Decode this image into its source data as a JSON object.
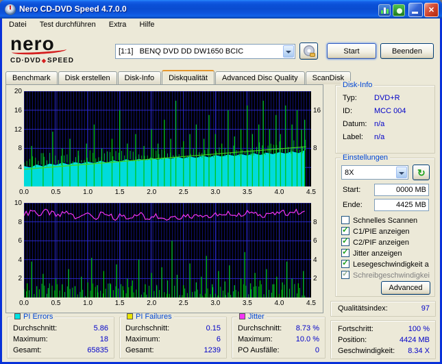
{
  "window": {
    "title": "Nero CD-DVD Speed 4.7.0.0"
  },
  "menu": {
    "items": [
      "Datei",
      "Test durchführen",
      "Extra",
      "Hilfe"
    ]
  },
  "logo": {
    "line1": "nero",
    "line2a": "CD·DVD",
    "diamond": "◆",
    "line2b": "SPEED"
  },
  "toolbar": {
    "drive": "[1:1]   BENQ DVD DD DW1650 BCIC",
    "start_label": "Start",
    "quit_label": "Beenden"
  },
  "tabs": {
    "items": [
      "Benchmark",
      "Disk erstellen",
      "Disk-Info",
      "Diskqualität",
      "Advanced Disc Quality",
      "ScanDisk"
    ],
    "active": "Diskqualität"
  },
  "disk_info": {
    "title": "Disk-Info",
    "rows": [
      {
        "label": "Typ:",
        "value": "DVD+R"
      },
      {
        "label": "ID:",
        "value": "MCC 004"
      },
      {
        "label": "Datum:",
        "value": "n/a"
      },
      {
        "label": "Label:",
        "value": "n/a"
      }
    ]
  },
  "settings": {
    "title": "Einstellungen",
    "speed": "8X",
    "start_label": "Start:",
    "start_value": "0000 MB",
    "end_label": "Ende:",
    "end_value": "4425 MB",
    "checkboxes": [
      {
        "label": "Schnelles Scannen",
        "checked": false,
        "disabled": false
      },
      {
        "label": "C1/PIE anzeigen",
        "checked": true,
        "disabled": false
      },
      {
        "label": "C2/PIF anzeigen",
        "checked": true,
        "disabled": false
      },
      {
        "label": "Jitter anzeigen",
        "checked": true,
        "disabled": false
      },
      {
        "label": "Lesegeschwindigkeit a",
        "checked": true,
        "disabled": false
      },
      {
        "label": "Schreibgeschwindigkei",
        "checked": true,
        "disabled": true
      }
    ],
    "advanced_label": "Advanced"
  },
  "quality": {
    "label": "Qualitätsindex:",
    "value": "97"
  },
  "progress": {
    "rows": [
      {
        "label": "Fortschritt:",
        "value": "100 %"
      },
      {
        "label": "Position:",
        "value": "4424 MB"
      },
      {
        "label": "Geschwindigkeit:",
        "value": "8.34 X"
      }
    ]
  },
  "stats": [
    {
      "title": "PI Errors",
      "color": "#00E3E3",
      "rows": [
        {
          "label": "Durchschnitt:",
          "value": "5.86"
        },
        {
          "label": "Maximum:",
          "value": "18"
        },
        {
          "label": "Gesamt:",
          "value": "65835"
        }
      ]
    },
    {
      "title": "PI Failures",
      "color": "#E8E300",
      "rows": [
        {
          "label": "Durchschnitt:",
          "value": "0.15"
        },
        {
          "label": "Maximum:",
          "value": "6"
        },
        {
          "label": "Gesamt:",
          "value": "1239"
        }
      ]
    },
    {
      "title": "Jitter",
      "color": "#F336F3",
      "rows": [
        {
          "label": "Durchschnitt:",
          "value": "8.73 %"
        },
        {
          "label": "Maximum:",
          "value": "10.0 %"
        },
        {
          "label": "PO Ausfälle:",
          "value": "0"
        }
      ]
    }
  ],
  "chart_data": [
    {
      "name": "PI Errors / Lesegeschwindigkeit",
      "type": "area",
      "x_max": 4.5,
      "x_tick_labels": [
        "0.0",
        "0.5",
        "1.0",
        "1.5",
        "2.0",
        "2.5",
        "3.0",
        "3.5",
        "4.0",
        "4.5"
      ],
      "y_left_max": 20,
      "y_left_ticks": [
        4,
        8,
        12,
        16,
        20
      ],
      "y_right_ticks": [
        8,
        16
      ],
      "series": [
        {
          "name": "PI Errors",
          "type": "area",
          "color": "#00DBDB",
          "x_step": 0.1,
          "values": [
            4.3,
            4.0,
            4.6,
            4.2,
            4.8,
            4.5,
            5.0,
            4.6,
            5.1,
            4.8,
            5.2,
            4.9,
            5.4,
            5.0,
            5.5,
            5.2,
            5.7,
            5.3,
            5.8,
            5.5,
            6.0,
            5.6,
            6.1,
            5.8,
            6.2,
            5.9,
            6.3,
            6.0,
            6.5,
            6.1,
            6.6,
            6.3,
            6.7,
            6.4,
            6.8,
            6.5,
            7.0,
            6.6,
            7.1,
            6.8,
            7.2,
            6.9,
            7.4,
            7.0,
            7.6
          ]
        },
        {
          "name": "PI Errors Streuung",
          "type": "grass",
          "above": true,
          "step": 0.045,
          "min": 0.4,
          "max": 2.4,
          "x_end": 4.42,
          "seed": 7,
          "color": "#00BF30"
        },
        {
          "name": "PI Errors Spitzen",
          "type": "spikes",
          "color": "#00C419",
          "points": [
            [
              0.12,
              8.5
            ],
            [
              0.3,
              7
            ],
            [
              0.45,
              11.5
            ],
            [
              0.6,
              8
            ],
            [
              0.72,
              10
            ],
            [
              0.85,
              7.5
            ],
            [
              0.98,
              9
            ],
            [
              1.1,
              13
            ],
            [
              1.22,
              8
            ],
            [
              1.38,
              10
            ],
            [
              1.5,
              16
            ],
            [
              1.62,
              9
            ],
            [
              1.75,
              11
            ],
            [
              1.88,
              8.5
            ],
            [
              2.0,
              12
            ],
            [
              2.1,
              9
            ],
            [
              2.2,
              14
            ],
            [
              2.3,
              10
            ],
            [
              2.38,
              18
            ],
            [
              2.5,
              9.5
            ],
            [
              2.6,
              11
            ],
            [
              2.7,
              13
            ],
            [
              2.82,
              10
            ],
            [
              2.9,
              15
            ],
            [
              3.0,
              11
            ],
            [
              3.1,
              9
            ],
            [
              3.2,
              16
            ],
            [
              3.3,
              10.5
            ],
            [
              3.4,
              12
            ],
            [
              3.5,
              17
            ],
            [
              3.58,
              11
            ],
            [
              3.68,
              13
            ],
            [
              3.75,
              18
            ],
            [
              3.85,
              12
            ],
            [
              3.95,
              15
            ],
            [
              4.02,
              11
            ],
            [
              4.1,
              17
            ],
            [
              4.2,
              13
            ],
            [
              4.28,
              16
            ],
            [
              4.35,
              12
            ],
            [
              4.4,
              14
            ]
          ]
        },
        {
          "name": "Lesegeschwindigkeit",
          "type": "line",
          "color": "#46D522",
          "x": [
            0,
            4.42
          ],
          "y": [
            3.6,
            8.34
          ]
        }
      ]
    },
    {
      "name": "Jitter / PI Failures",
      "type": "line",
      "x_max": 4.5,
      "x_tick_labels": [
        "0.0",
        "0.5",
        "1.0",
        "1.5",
        "2.0",
        "2.5",
        "3.0",
        "3.5",
        "4.0",
        "4.5"
      ],
      "y_left_max": 10,
      "y_left_ticks": [
        2,
        4,
        6,
        8,
        10
      ],
      "y_right_ticks": [
        2,
        4,
        6,
        8
      ],
      "series": [
        {
          "name": "PI Failures Rauschen",
          "type": "grass",
          "above": false,
          "step": 0.04,
          "min": 0.15,
          "max": 1.5,
          "x_end": 4.42,
          "seed": 3,
          "color": "#00C419"
        },
        {
          "name": "PI Failures",
          "type": "spikes",
          "color": "#00C419",
          "points": [
            [
              0.05,
              1.5
            ],
            [
              0.12,
              3.8
            ],
            [
              0.2,
              1.2
            ],
            [
              0.3,
              2.5
            ],
            [
              0.38,
              1.0
            ],
            [
              0.5,
              2.0
            ],
            [
              0.6,
              1.4
            ],
            [
              0.7,
              3.0
            ],
            [
              0.8,
              1.2
            ],
            [
              0.9,
              2.2
            ],
            [
              1.0,
              1.6
            ],
            [
              1.06,
              4.2
            ],
            [
              1.15,
              1.3
            ],
            [
              1.25,
              2.8
            ],
            [
              1.35,
              1.5
            ],
            [
              1.45,
              3.5
            ],
            [
              1.55,
              1.2
            ],
            [
              1.62,
              2.0
            ],
            [
              1.7,
              1.8
            ],
            [
              1.8,
              4.0
            ],
            [
              1.9,
              1.4
            ],
            [
              2.0,
              2.6
            ],
            [
              2.08,
              1.2
            ],
            [
              2.16,
              3.2
            ],
            [
              2.25,
              1.8
            ],
            [
              2.32,
              6.0
            ],
            [
              2.4,
              2.4
            ],
            [
              2.5,
              1.3
            ],
            [
              2.6,
              3.6
            ],
            [
              2.7,
              1.6
            ],
            [
              2.78,
              2.2
            ],
            [
              2.86,
              4.4
            ],
            [
              2.95,
              1.4
            ],
            [
              3.05,
              2.8
            ],
            [
              3.15,
              1.7
            ],
            [
              3.22,
              3.4
            ],
            [
              3.3,
              1.3
            ],
            [
              3.4,
              2.0
            ],
            [
              3.46,
              4.8
            ],
            [
              3.55,
              1.5
            ],
            [
              3.62,
              2.6
            ],
            [
              3.7,
              1.8
            ],
            [
              3.8,
              3.0
            ],
            [
              3.9,
              1.4
            ],
            [
              3.96,
              2.2
            ],
            [
              4.05,
              1.6
            ],
            [
              4.12,
              3.8
            ],
            [
              4.2,
              2.0
            ],
            [
              4.3,
              1.5
            ],
            [
              4.38,
              2.8
            ]
          ]
        },
        {
          "name": "Jitter",
          "type": "noisyline",
          "color": "#F336F3",
          "x_step": 0.1,
          "x_end": 4.42,
          "values": [
            8.9,
            9.2,
            8.8,
            9.1,
            8.9,
            8.6,
            9.0,
            8.8,
            8.5,
            8.9,
            8.7,
            8.4,
            8.8,
            8.6,
            8.3,
            8.7,
            8.5,
            8.6,
            8.8,
            8.4,
            8.7,
            8.6,
            8.3,
            8.6,
            8.5,
            8.7,
            8.6,
            8.8,
            8.7,
            8.5,
            8.8,
            8.6,
            8.9,
            8.7,
            8.8,
            9.0,
            8.8,
            8.7,
            8.9,
            8.8,
            9.0,
            8.9,
            9.1,
            8.9,
            9.0
          ]
        }
      ]
    }
  ]
}
